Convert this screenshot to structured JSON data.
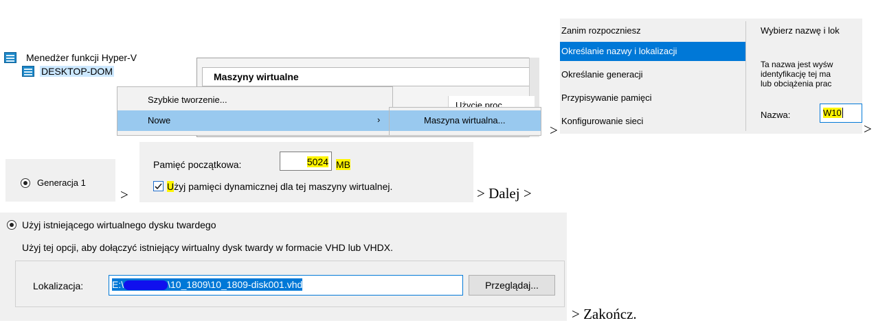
{
  "hyperv": {
    "tree_root": "Menedżer funkcji Hyper-V",
    "tree_host": "DESKTOP-DOM",
    "vm_panel_title": "Maszyny wirtualne",
    "column_cpu": "Użycie proc...",
    "menu_quick_create": "Szybkie tworzenie...",
    "menu_new": "Nowe",
    "menu_new_arrow": "›",
    "submenu_vm": "Maszyna wirtualna..."
  },
  "wizard": {
    "steps": [
      "Zanim rozpoczniesz",
      "Określanie nazwy i lokalizacji",
      "Określanie generacji",
      "Przypisywanie pamięci",
      "Konfigurowanie sieci"
    ],
    "right_title": "Wybierz nazwę i lok",
    "desc_lines": [
      "Ta nazwa jest wyśw",
      "identyfikację tej ma",
      "lub obciążenia prac"
    ],
    "name_label": "Nazwa:",
    "name_value": "W10"
  },
  "generation": {
    "label": "Generacja 1"
  },
  "memory": {
    "label": "Pamięć początkowa:",
    "value": "5024",
    "unit": "MB",
    "dynamic_label_first": "U",
    "dynamic_label_rest": "żyj pamięci dynamicznej dla tej maszyny wirtualnej."
  },
  "disk": {
    "option_label": "Użyj istniejącego wirtualnego dysku twardego",
    "option_desc": "Użyj tej opcji, aby dołączyć istniejący wirtualny dysk twardy w formacie VHD lub VHDX.",
    "location_label": "Lokalizacja:",
    "location_prefix": "E:\\",
    "location_rest": "\\10_1809\\10_1809-disk001.vhd",
    "browse_button": "Przeglądaj..."
  },
  "flow": {
    "arrow": ">",
    "dalej": "> Dalej >",
    "zakoncz": "> Zakończ."
  }
}
